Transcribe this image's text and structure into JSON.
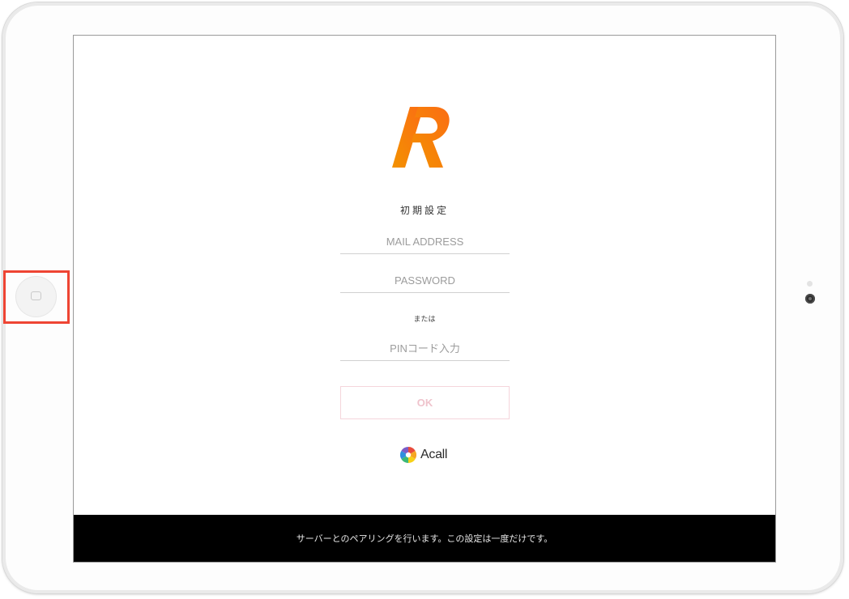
{
  "colors": {
    "accent_orange": "#f39200",
    "ok_border": "#f5d5db",
    "ok_text": "#efc3cc",
    "footer_bg": "#000000",
    "highlight": "#ee4433"
  },
  "device": {
    "home_button_icon": "home-button-icon",
    "camera_icon": "front-camera-icon"
  },
  "app": {
    "logo_icon": "r-logo-icon",
    "title": "初期設定",
    "fields": {
      "mail_placeholder": "MAIL ADDRESS",
      "password_placeholder": "PASSWORD",
      "or_text": "または",
      "pin_placeholder": "PINコード入力"
    },
    "ok_label": "OK",
    "brand": {
      "icon": "acall-logo-icon",
      "name": "Acall"
    },
    "footer_message": "サーバーとのペアリングを行います。この設定は一度だけです。"
  }
}
